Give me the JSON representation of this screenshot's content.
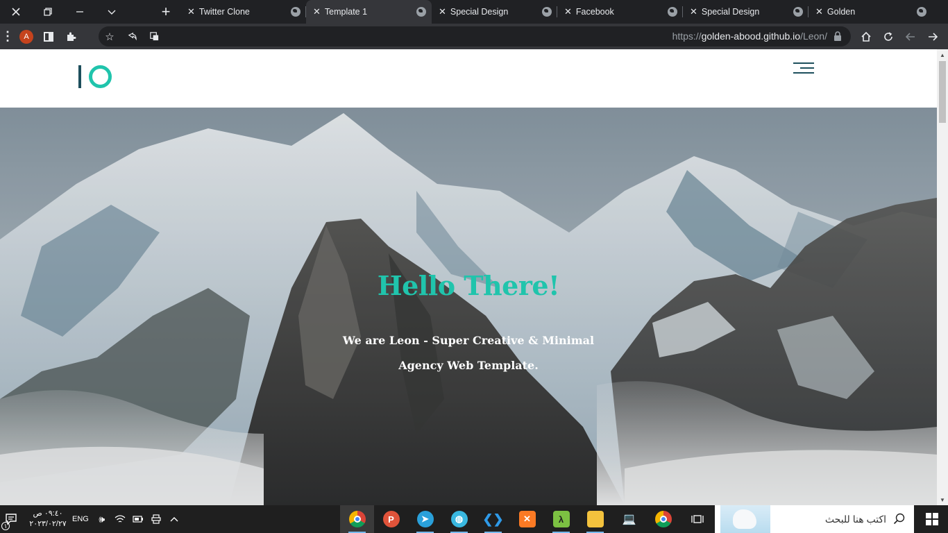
{
  "browser": {
    "tabs": [
      {
        "title": "Twitter Clone",
        "active": false
      },
      {
        "title": "Template 1",
        "active": true
      },
      {
        "title": "Special Design",
        "active": false
      },
      {
        "title": "Facebook",
        "active": false
      },
      {
        "title": "Special Design",
        "active": false
      },
      {
        "title": "Golden",
        "active": false
      }
    ],
    "profile_initial": "A",
    "url": {
      "scheme": "https://",
      "host": "golden-abood.github.io",
      "path": "/Leon/"
    }
  },
  "site": {
    "hero": {
      "title": "Hello There!",
      "subtitle": "We are Leon - Super Creative & Minimal Agency Web Template."
    },
    "accent_color": "#20c4ac",
    "dark_color": "#1d4f5c"
  },
  "taskbar": {
    "time": "٠٩:٤٠ ص",
    "date": "٢٠٢٣/٠٢/٢٧",
    "language": "ENG",
    "notification_count": "١",
    "search_placeholder": "اكتب هنا للبحث"
  }
}
